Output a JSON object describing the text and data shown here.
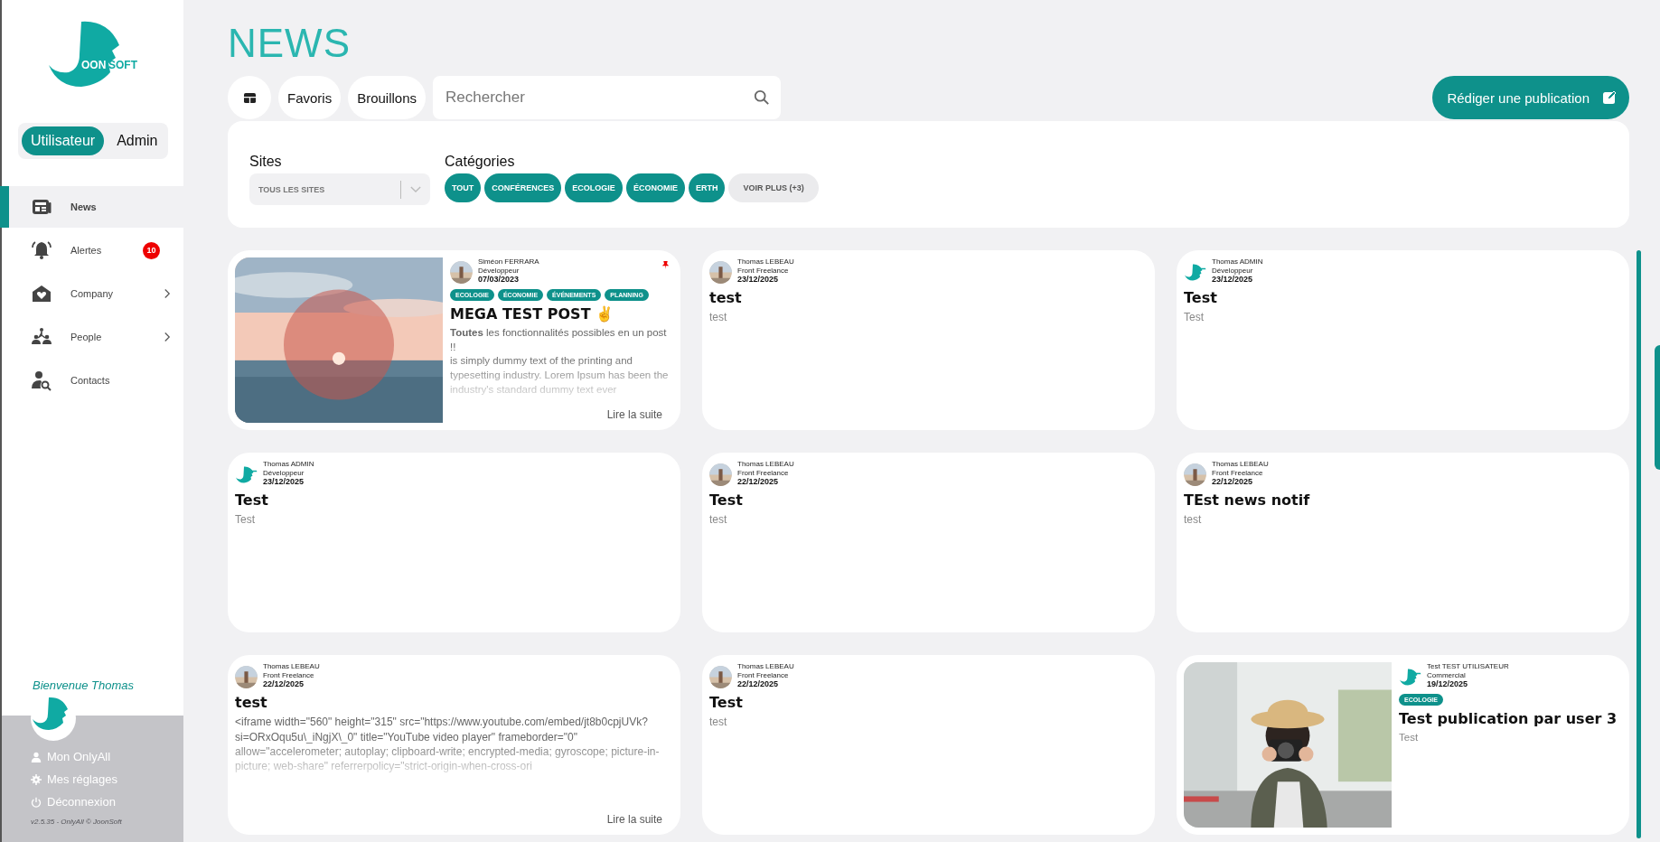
{
  "sidebar": {
    "logo": {
      "part_a": "OON",
      "part_b": "SOFT"
    },
    "mode_toggle": [
      {
        "label": "Utilisateur",
        "selected": true
      },
      {
        "label": "Admin",
        "selected": false
      }
    ],
    "items": [
      {
        "label": "News",
        "selected": true,
        "has_submenu": false
      },
      {
        "label": "Alertes",
        "selected": false,
        "badge": "10",
        "has_submenu": false
      },
      {
        "label": "Company",
        "selected": false,
        "has_submenu": true
      },
      {
        "label": "People",
        "selected": false,
        "has_submenu": true
      },
      {
        "label": "Contacts",
        "selected": false,
        "has_submenu": false
      }
    ],
    "welcome": "Bienvenue Thomas",
    "user_menu": [
      {
        "label": "Mon OnlyAll"
      },
      {
        "label": "Mes réglages"
      },
      {
        "label": "Déconnexion"
      }
    ],
    "version": "v2.5.35 - OnlyAll © JoonSoft"
  },
  "page_title": "NEWS",
  "toolbar": {
    "filters": [
      {
        "label": "Favoris"
      },
      {
        "label": "Brouillons"
      }
    ],
    "search": {
      "placeholder": "Rechercher"
    },
    "compose_button": "Rédiger une publication"
  },
  "filter_panel": {
    "sites_label": "Sites",
    "sites_select": "TOUS LES SITES",
    "categories_label": "Catégories",
    "categories": [
      {
        "label": "TOUT",
        "kind": "category",
        "selected": true
      },
      {
        "label": "CONFÉRENCES",
        "kind": "category",
        "selected": true
      },
      {
        "label": "ECOLOGIE",
        "kind": "category",
        "selected": true
      },
      {
        "label": "ÉCONOMIE",
        "kind": "category",
        "selected": true
      },
      {
        "label": "ERTH",
        "kind": "category",
        "selected": true
      },
      {
        "label": "VOIR PLUS (+3)",
        "kind": "more"
      }
    ]
  },
  "posts": [
    {
      "author": "Siméon FERRARA",
      "role": "Développeur",
      "date": "07/03/2023",
      "avatar": {
        "kind": "picture"
      },
      "pinned": true,
      "image": {
        "kind": "picture"
      },
      "tags": [
        "ECOLOGIE",
        "ÉCONOMIE",
        "ÉVÉNEMENTS",
        "PLANNING"
      ],
      "title": "MEGA TEST POST ✌️",
      "excerpt": "**Toutes** les fonctionnalités possibles en un post !!\nis simply dummy text of the printing and typesetting industry. Lorem Ipsum has been the industry's standard dummy text ever",
      "read_more": "Lire la suite"
    },
    {
      "author": "Thomas LEBEAU",
      "role": "Front Freelance",
      "date": "23/12/2025",
      "avatar": {
        "kind": "picture"
      },
      "pinned": false,
      "title": "test",
      "excerpt": "test"
    },
    {
      "author": "Thomas ADMIN",
      "role": "Développeur",
      "date": "23/12/2025",
      "avatar": {
        "kind": "logo"
      },
      "pinned": false,
      "title": "Test",
      "excerpt": "Test"
    },
    {
      "author": "Thomas ADMIN",
      "role": "Développeur",
      "date": "23/12/2025",
      "avatar": {
        "kind": "logo"
      },
      "pinned": false,
      "title": "Test",
      "excerpt": "Test"
    },
    {
      "author": "Thomas LEBEAU",
      "role": "Front Freelance",
      "date": "22/12/2025",
      "avatar": {
        "kind": "picture"
      },
      "pinned": false,
      "title": "Test",
      "excerpt": "test"
    },
    {
      "author": "Thomas LEBEAU",
      "role": "Front Freelance",
      "date": "22/12/2025",
      "avatar": {
        "kind": "picture"
      },
      "pinned": false,
      "title": "TEst news notif",
      "excerpt": "test"
    },
    {
      "author": "Thomas LEBEAU",
      "role": "Front Freelance",
      "date": "22/12/2025",
      "avatar": {
        "kind": "picture"
      },
      "pinned": false,
      "title": "test",
      "excerpt": "<iframe width=\"560\" height=\"315\" src=\"https://www.youtube.com/embed/jt8b0cpjUVk?si=ORxOqu5u\\_iNgjX\\_0\" title=\"YouTube video player\" frameborder=\"0\" allow=\"accelerometer; autoplay; clipboard-write; encrypted-media; gyroscope; picture-in-picture; web-share\" referrerpolicy=\"strict-origin-when-cross-ori",
      "read_more": "Lire la suite"
    },
    {
      "author": "Thomas LEBEAU",
      "role": "Front Freelance",
      "date": "22/12/2025",
      "avatar": {
        "kind": "picture"
      },
      "pinned": false,
      "title": "Test",
      "excerpt": "test"
    },
    {
      "author": "Test TEST UTILISATEUR",
      "role": "Commercial",
      "date": "19/12/2025",
      "avatar": {
        "kind": "logo"
      },
      "pinned": false,
      "image": {
        "kind": "picture"
      },
      "tags": [
        "ECOLOGIE"
      ],
      "title": "Test publication par user 3",
      "excerpt": "Test"
    }
  ]
}
